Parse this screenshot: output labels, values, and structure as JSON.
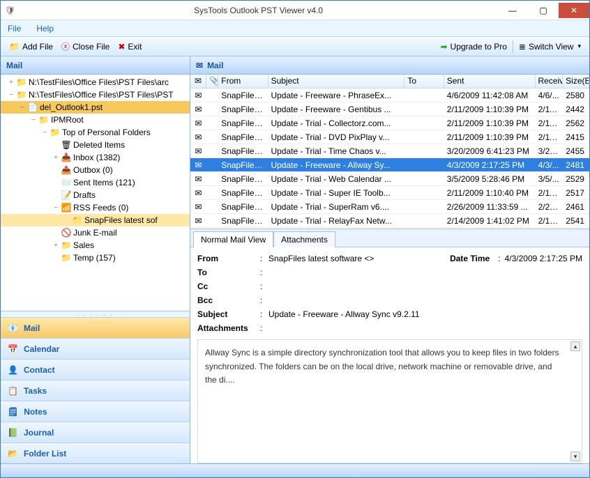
{
  "window": {
    "title": "SysTools Outlook PST Viewer v4.0"
  },
  "menu": {
    "file": "File",
    "help": "Help"
  },
  "toolbar": {
    "add_file": "Add File",
    "close_file": "Close File",
    "exit": "Exit",
    "upgrade": "Upgrade to Pro",
    "switch_view": "Switch View"
  },
  "left": {
    "header": "Mail",
    "tree": [
      {
        "pad": 0,
        "tw": "+",
        "icon": "folder",
        "label": "N:\\TestFiles\\Office Files\\PST Files\\arc",
        "sel": false
      },
      {
        "pad": 0,
        "tw": "−",
        "icon": "folder",
        "label": "N:\\TestFiles\\Office Files\\PST Files\\PST",
        "sel": false
      },
      {
        "pad": 1,
        "tw": "−",
        "icon": "pst",
        "label": "del_Outlook1.pst",
        "sel": "strong"
      },
      {
        "pad": 2,
        "tw": "−",
        "icon": "folder",
        "label": "IPMRoot",
        "sel": false
      },
      {
        "pad": 3,
        "tw": "−",
        "icon": "folder",
        "label": "Top of Personal Folders",
        "sel": false
      },
      {
        "pad": 4,
        "tw": "",
        "icon": "deleted",
        "label": "Deleted Items",
        "sel": false
      },
      {
        "pad": 4,
        "tw": "+",
        "icon": "inbox",
        "label": "Inbox  (1382)",
        "sel": false
      },
      {
        "pad": 4,
        "tw": "",
        "icon": "outbox",
        "label": "Outbox  (0)",
        "sel": false
      },
      {
        "pad": 4,
        "tw": "",
        "icon": "sent",
        "label": "Sent Items  (121)",
        "sel": false
      },
      {
        "pad": 4,
        "tw": "",
        "icon": "drafts",
        "label": "Drafts",
        "sel": false
      },
      {
        "pad": 4,
        "tw": "−",
        "icon": "rss",
        "label": "RSS Feeds  (0)",
        "sel": false
      },
      {
        "pad": 5,
        "tw": "",
        "icon": "folder",
        "label": "SnapFiles latest sof",
        "sel": "weak"
      },
      {
        "pad": 4,
        "tw": "",
        "icon": "junk",
        "label": "Junk E-mail",
        "sel": false
      },
      {
        "pad": 4,
        "tw": "+",
        "icon": "folder",
        "label": "Sales",
        "sel": false
      },
      {
        "pad": 4,
        "tw": "",
        "icon": "folder",
        "label": "Temp  (157)",
        "sel": false
      }
    ],
    "nav": [
      {
        "label": "Mail",
        "icon": "mail",
        "active": true
      },
      {
        "label": "Calendar",
        "icon": "calendar",
        "active": false
      },
      {
        "label": "Contact",
        "icon": "contact",
        "active": false
      },
      {
        "label": "Tasks",
        "icon": "tasks",
        "active": false
      },
      {
        "label": "Notes",
        "icon": "notes",
        "active": false
      },
      {
        "label": "Journal",
        "icon": "journal",
        "active": false
      },
      {
        "label": "Folder List",
        "icon": "folderlist",
        "active": false
      }
    ]
  },
  "right": {
    "header": "Mail",
    "columns": {
      "from": "From",
      "subject": "Subject",
      "to": "To",
      "sent": "Sent",
      "received": "Receive",
      "size": "Size(B"
    },
    "rows": [
      {
        "from": "SnapFiles...",
        "subject": "Update -  Freeware -  PhraseEx...",
        "to": "",
        "sent": "4/6/2009 11:42:08 AM",
        "recv": "4/6/...",
        "size": "2580",
        "sel": false
      },
      {
        "from": "SnapFiles...",
        "subject": "Update -  Freeware -  Gentibus ...",
        "to": "",
        "sent": "2/11/2009 1:10:39 PM",
        "recv": "2/11...",
        "size": "2442",
        "sel": false
      },
      {
        "from": "SnapFiles...",
        "subject": "Update -  Trial -  Collectorz.com...",
        "to": "",
        "sent": "2/11/2009 1:10:39 PM",
        "recv": "2/11...",
        "size": "2562",
        "sel": false
      },
      {
        "from": "SnapFiles...",
        "subject": "Update -  Trial -  DVD PixPlay   v...",
        "to": "",
        "sent": "2/11/2009 1:10:39 PM",
        "recv": "2/11...",
        "size": "2415",
        "sel": false
      },
      {
        "from": "SnapFiles...",
        "subject": "Update -  Trial -  Time Chaos   v...",
        "to": "",
        "sent": "3/20/2009 6:41:23 PM",
        "recv": "3/20...",
        "size": "2455",
        "sel": false
      },
      {
        "from": "SnapFiles...",
        "subject": "Update -  Freeware -  Allway Sy...",
        "to": "",
        "sent": "4/3/2009 2:17:25 PM",
        "recv": "4/3/...",
        "size": "2481",
        "sel": true
      },
      {
        "from": "SnapFiles...",
        "subject": "Update -  Trial -  Web Calendar ...",
        "to": "",
        "sent": "3/5/2009 5:28:46 PM",
        "recv": "3/5/...",
        "size": "2529",
        "sel": false
      },
      {
        "from": "SnapFiles...",
        "subject": "Update -  Trial -  Super IE Toolb...",
        "to": "",
        "sent": "2/11/2009 1:10:40 PM",
        "recv": "2/11...",
        "size": "2517",
        "sel": false
      },
      {
        "from": "SnapFiles...",
        "subject": "Update -  Trial -  SuperRam   v6....",
        "to": "",
        "sent": "2/26/2009 11:33:59 ...",
        "recv": "2/26...",
        "size": "2461",
        "sel": false
      },
      {
        "from": "SnapFiles...",
        "subject": "Update -  Trial -  RelayFax Netw...",
        "to": "",
        "sent": "2/14/2009 1:41:02 PM",
        "recv": "2/14...",
        "size": "2541",
        "sel": false
      }
    ],
    "tabs": {
      "normal": "Normal Mail View",
      "attachments": "Attachments"
    },
    "preview": {
      "labels": {
        "from": "From",
        "to": "To",
        "cc": "Cc",
        "bcc": "Bcc",
        "subject": "Subject",
        "attachments": "Attachments",
        "datetime": "Date Time"
      },
      "from": "SnapFiles latest software <>",
      "to": "",
      "cc": "",
      "bcc": "",
      "subject": "Update -  Freeware -  Allway Sync   v9.2.11",
      "attachments": "",
      "datetime": "4/3/2009 2:17:25 PM",
      "body": "Allway Sync is a simple directory synchronization tool that allows you to keep files in two folders synchronized. The folders can be on the local drive, network machine or removable drive, and the di...."
    }
  }
}
